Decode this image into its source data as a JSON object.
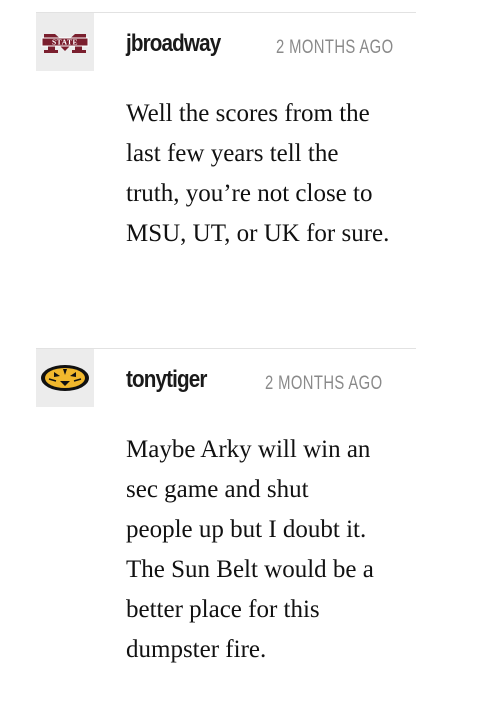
{
  "comments": [
    {
      "username": "jbroadway",
      "timestamp": "2 MONTHS AGO",
      "avatar": {
        "icon": "msu-state-logo-icon",
        "text": "STATE",
        "color": "#7a1f2e"
      },
      "lines": [
        "Well the scores from the",
        "last few years tell the",
        "truth, you’re not close to",
        "MSU, UT, or UK for sure."
      ]
    },
    {
      "username": "tonytiger",
      "timestamp": "2 MONTHS AGO",
      "avatar": {
        "icon": "mizzou-tiger-logo-icon",
        "color": "#f1b82d"
      },
      "lines": [
        "Maybe Arky will win an",
        "sec game and shut",
        "people up but I doubt it.",
        "The Sun Belt would be a",
        "better place for this",
        "dumpster fire."
      ]
    }
  ]
}
